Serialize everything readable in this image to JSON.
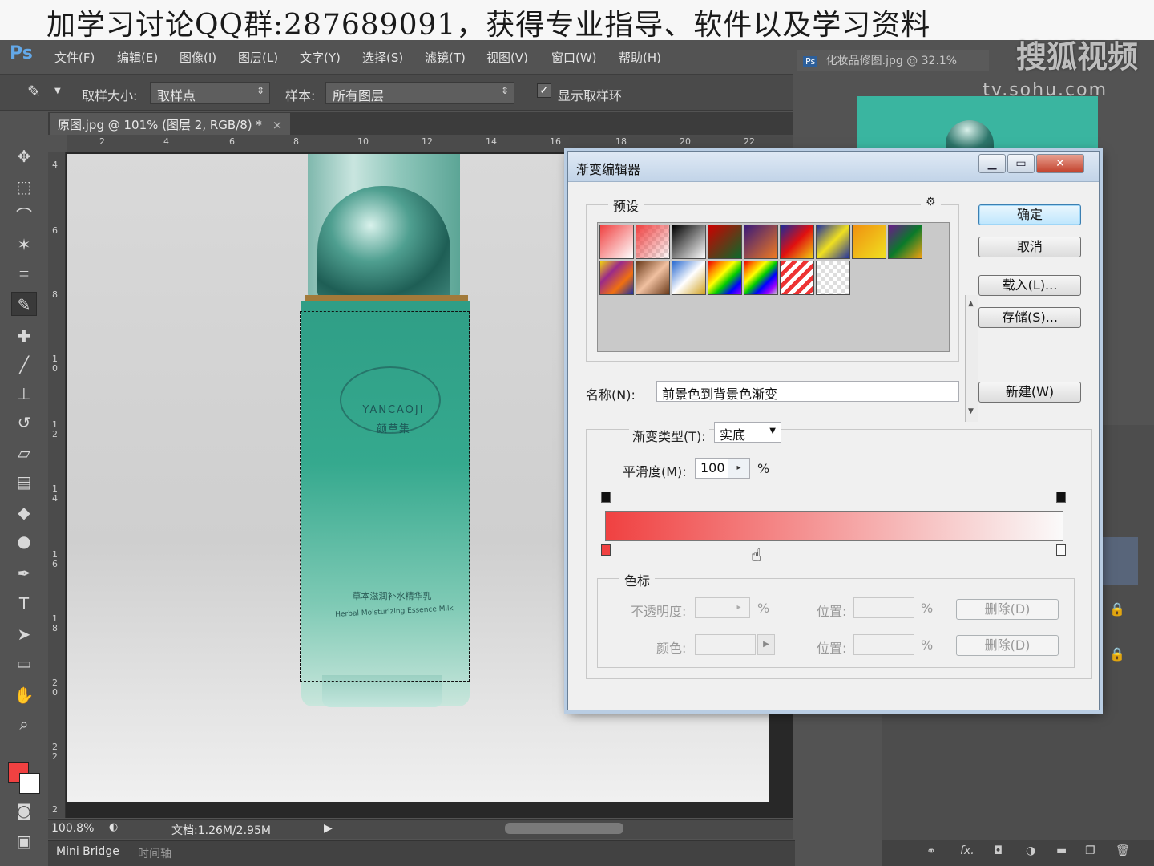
{
  "banner": {
    "text": "加学习讨论QQ群:287689091，获得专业指导、软件以及学习资料",
    "watermark": "搜狐视频",
    "watermark_url": "tv.sohu.com"
  },
  "app": {
    "logo": "Ps",
    "menu": [
      "文件(F)",
      "编辑(E)",
      "图像(I)",
      "图层(L)",
      "文字(Y)",
      "选择(S)",
      "滤镜(T)",
      "视图(V)",
      "窗口(W)",
      "帮助(H)"
    ]
  },
  "options": {
    "sample_size_label": "取样大小:",
    "sample_size_value": "取样点",
    "sample_label": "样本:",
    "sample_value": "所有图层",
    "show_ring_label": "显示取样环",
    "show_ring_checked": true
  },
  "document": {
    "tab_title": "原图.jpg @ 101% (图层 2, RGB/8) *",
    "tab_close": "×",
    "second_tab_title": "化妆品修图.jpg @ 32.1%",
    "hruler_ticks": [
      "2",
      "4",
      "6",
      "8",
      "10",
      "12",
      "14",
      "16",
      "18",
      "20",
      "22"
    ],
    "vruler_ticks": [
      "4",
      "6",
      "8",
      "1\n0",
      "1\n2",
      "1\n4",
      "1\n6",
      "1\n8",
      "2\n0",
      "2\n2",
      "2"
    ],
    "zoom": "100.8%",
    "doc_size": "文档:1.26M/2.95M"
  },
  "product": {
    "brand_en": "YANCAOJI",
    "brand_cn": "颜草集",
    "name_cn": "草本滋润补水精华乳",
    "name_en": "Herbal Moisturizing Essence Milk"
  },
  "bottom_tabs": [
    "Mini Bridge",
    "时间轴"
  ],
  "colors": {
    "foreground": "#f04141",
    "background": "#ffffff"
  },
  "dialog": {
    "title": "渐变编辑器",
    "presets_label": "预设",
    "gear_icon": "⚙",
    "buttons": {
      "ok": "确定",
      "cancel": "取消",
      "load": "载入(L)...",
      "save": "存储(S)...",
      "new": "新建(W)"
    },
    "name_label": "名称(N):",
    "name_value": "前景色到背景色渐变",
    "gradient_type_label": "渐变类型(T):",
    "gradient_type_value": "实底",
    "smoothness_label": "平滑度(M):",
    "smoothness_value": "100",
    "percent": "%",
    "stops_label": "色标",
    "opacity_label": "不透明度:",
    "color_label": "颜色:",
    "location_label": "位置:",
    "delete_button": "删除(D)",
    "gradient_start_color": "#f04141",
    "gradient_end_color": "#fafafa"
  }
}
